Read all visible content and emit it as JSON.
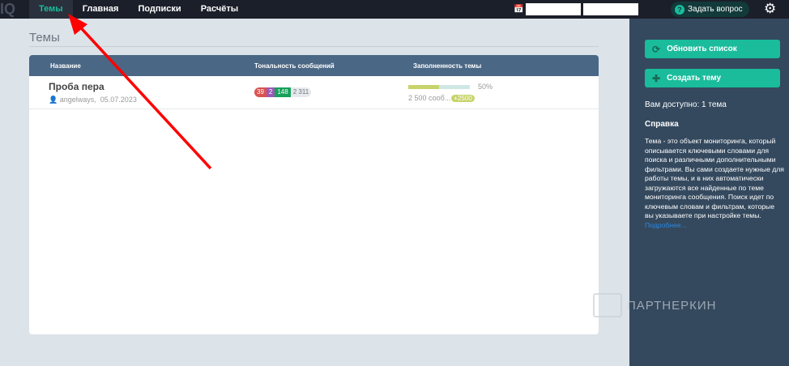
{
  "nav": {
    "logo": "IQ",
    "items": [
      {
        "label": "Темы",
        "active": true
      },
      {
        "label": "Главная"
      },
      {
        "label": "Подписки"
      },
      {
        "label": "Расчёты"
      }
    ],
    "date_from": "",
    "date_to": "",
    "ask_label": "Задать вопрос",
    "question_icon": "?"
  },
  "main": {
    "title": "Темы",
    "columns": [
      "Название",
      "Тональность сообщений",
      "Заполненность темы"
    ],
    "rows": [
      {
        "name": "Проба пера",
        "author": "angelways",
        "date": "05.07.2023",
        "tone": {
          "negative": "39",
          "mixed": "2",
          "positive": "148",
          "neutral": "2 311"
        },
        "fill_percent": 50,
        "fill_label": "50%",
        "count": "2 500 сооб...",
        "added": "+2500"
      }
    ]
  },
  "sidebar": {
    "refresh_label": "Обновить список",
    "create_label": "Создать тему",
    "available": "Вам доступно: 1 тема",
    "help_title": "Справка",
    "help_text": "Тема - это объект мониторинга, который описывается ключевыми словами для поиска и различными дополнительными фильтрами. Вы сами создаете нужные для работы темы, и в них автоматически загружаются все найденные по теме мониторинга сообщения. Поиск идет по ключевым словам и фильтрам, которые вы указываете при настройке темы.",
    "more_link": "Подробнее..."
  },
  "watermark": "ПАРТНЕРКИН",
  "colors": {
    "accent": "#1abc9c",
    "topbar": "#1b1f2a",
    "sidebar": "#34495e",
    "table_header": "#4a6785",
    "negative": "#d9534f",
    "mixed": "#9b59b6",
    "positive": "#16a05a",
    "arrow": "#ff0000"
  }
}
